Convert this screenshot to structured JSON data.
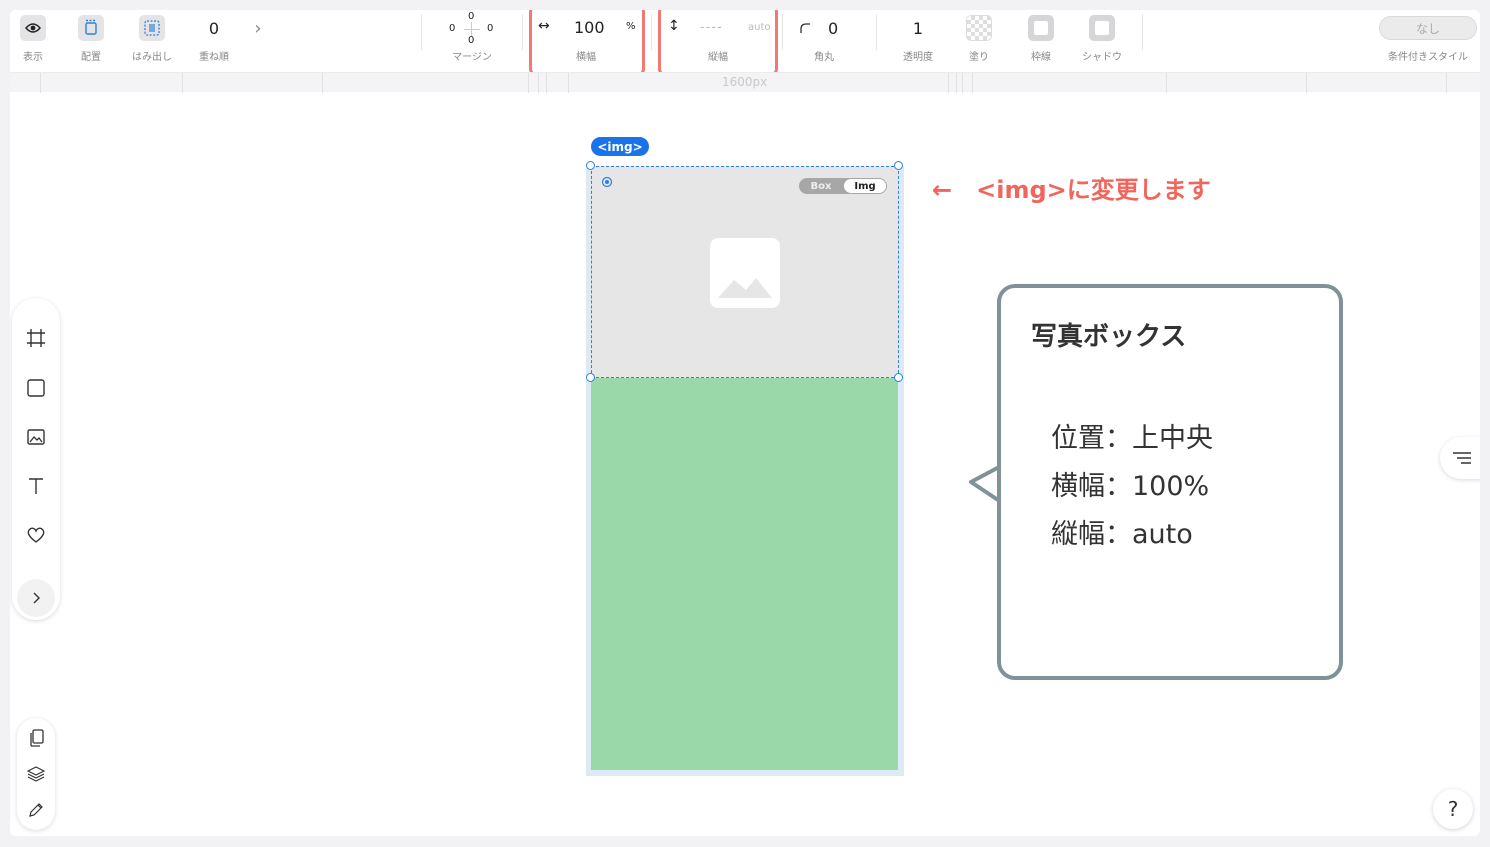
{
  "toolbar": {
    "display_label": "表示",
    "placement_label": "配置",
    "overflow_label": "はみ出し",
    "zorder_value": "0",
    "zorder_label": "重ね順",
    "more_glyph": "›",
    "margin": {
      "top": "0",
      "left": "0",
      "right": "0",
      "bottom": "0",
      "label": "マージン"
    },
    "width": {
      "glyph": "↔",
      "value": "100",
      "unit": "%",
      "label": "横幅"
    },
    "height": {
      "glyph": "↕",
      "value": "----",
      "unit": "auto",
      "label": "縦幅"
    },
    "radius": {
      "value": "0",
      "label": "角丸"
    },
    "opacity": {
      "value": "1",
      "label": "透明度"
    },
    "fill_label": "塗り",
    "border_label": "枠線",
    "shadow_label": "シャドウ",
    "conditional": {
      "value": "なし",
      "label": "条件付きスタイル"
    }
  },
  "ruler": {
    "label": "1600px"
  },
  "canvas": {
    "tag": "<img>",
    "toggle": {
      "box": "Box",
      "img": "Img",
      "active": "Img"
    },
    "annotation": "←　<img>に変更します"
  },
  "callout": {
    "title": "写真ボックス",
    "lines": [
      "位置：上中央",
      "横幅：100%",
      "縦幅：auto"
    ]
  },
  "help": {
    "label": "?"
  },
  "colors": {
    "accent": "#1a73e8",
    "highlight": "#f07a72",
    "annotation": "#f0665d",
    "green": "#9ad8aa",
    "callout_border": "#7e9298"
  }
}
